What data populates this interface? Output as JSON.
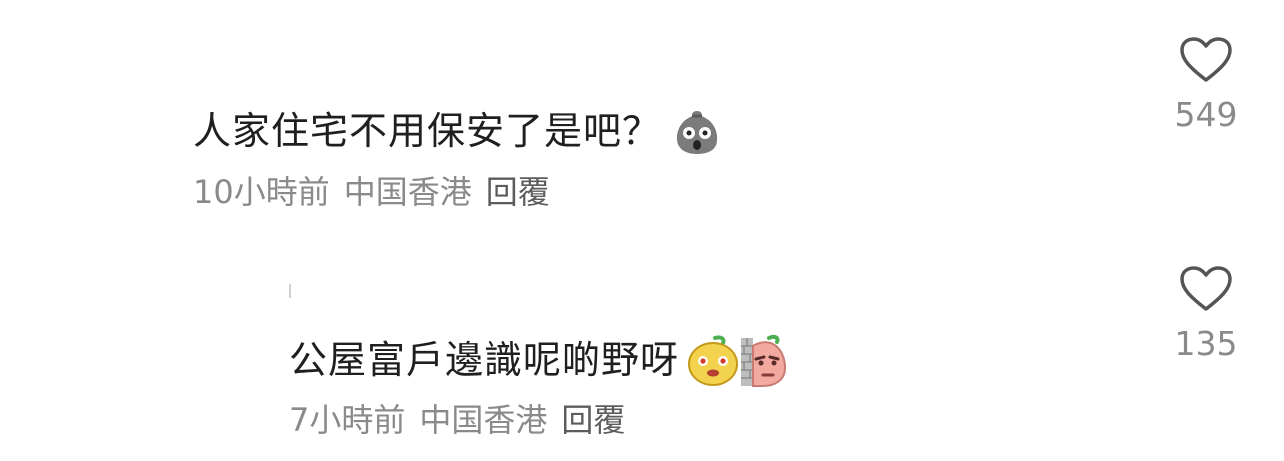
{
  "comments": [
    {
      "text": "人家住宅不用保安了是吧？",
      "emoji": "shocked-bag-face-icon",
      "time": "10小時前",
      "location": "中国香港",
      "reply_label": "回覆",
      "likes": "549"
    },
    {
      "text": "公屋富戶邊識呢啲野呀",
      "emoji": "yellow-face-and-peeking-pink-face-icon",
      "time": "7小時前",
      "location": "中国香港",
      "reply_label": "回覆",
      "likes": "135"
    }
  ]
}
